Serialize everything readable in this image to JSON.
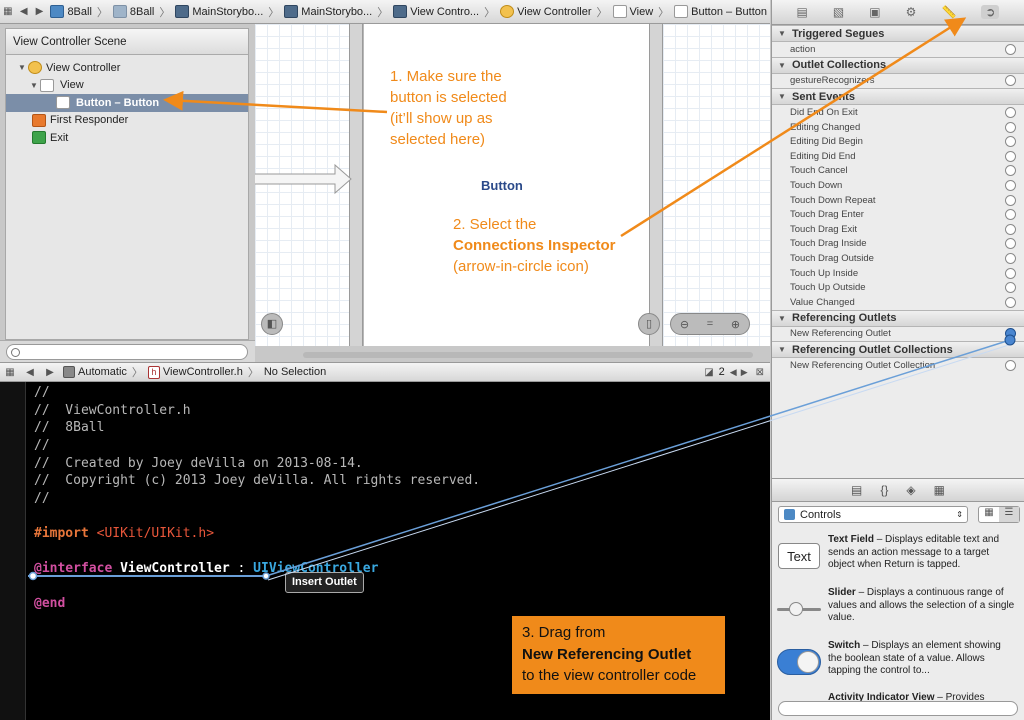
{
  "jumpbar_top": {
    "crumbs": [
      "8Ball",
      "8Ball",
      "MainStorybo...",
      "MainStorybo...",
      "View Contro...",
      "View Controller",
      "View",
      "Button – Button"
    ]
  },
  "outline": {
    "scene": "View Controller Scene",
    "items": [
      "View Controller",
      "View",
      "Button – Button",
      "First Responder",
      "Exit"
    ]
  },
  "canvas": {
    "button_label": "Button"
  },
  "inspector": {
    "sections": [
      {
        "title": "Triggered Segues",
        "rows": [
          "action"
        ]
      },
      {
        "title": "Outlet Collections",
        "rows": [
          "gestureRecognizers"
        ]
      },
      {
        "title": "Sent Events",
        "rows": [
          "Did End On Exit",
          "Editing Changed",
          "Editing Did Begin",
          "Editing Did End",
          "Touch Cancel",
          "Touch Down",
          "Touch Down Repeat",
          "Touch Drag Enter",
          "Touch Drag Exit",
          "Touch Drag Inside",
          "Touch Drag Outside",
          "Touch Up Inside",
          "Touch Up Outside",
          "Value Changed"
        ]
      },
      {
        "title": "Referencing Outlets",
        "rows": [
          "New Referencing Outlet"
        ]
      },
      {
        "title": "Referencing Outlet Collections",
        "rows": [
          "New Referencing Outlet Collection"
        ]
      }
    ]
  },
  "editor_bar": {
    "mode": "Automatic",
    "file": "ViewController.h",
    "selection": "No Selection",
    "counterpart_count": "2"
  },
  "code": {
    "l1": "//",
    "l2": "//  ViewController.h",
    "l3": "//  8Ball",
    "l4": "//",
    "l5": "//  Created by Joey deVilla on 2013-08-14.",
    "l6": "//  Copyright (c) 2013 Joey deVilla. All rights reserved.",
    "l7": "//",
    "import_kw": "#import",
    "import_val": "<UIKit/UIKit.h>",
    "iface_kw": "@interface",
    "iface_name": "ViewController",
    "iface_colon": ":",
    "iface_super": "UIViewController",
    "end_kw": "@end"
  },
  "tooltip": "Insert Outlet",
  "annotations": {
    "a1": [
      "1. Make sure the",
      "button is selected",
      "(it’ll show up as",
      "selected here)"
    ],
    "a2_1": "2. Select the",
    "a2_2": "Connections Inspector",
    "a2_3": "(arrow-in-circle icon)",
    "a3_1": "3. Drag from",
    "a3_2": "New Referencing Outlet",
    "a3_3": "to the view controller code"
  },
  "library": {
    "dropdown": "Controls",
    "items": [
      {
        "thumb": "Text",
        "name": "Text Field",
        "desc": " – Displays editable text and sends an action message to a target object when Return is tapped."
      },
      {
        "name": "Slider",
        "desc": " – Displays a continuous range of values and allows the selection of a single value."
      },
      {
        "name": "Switch",
        "desc": " – Displays an element showing the boolean state of a value. Allows tapping the control to..."
      },
      {
        "name": "Activity Indicator View",
        "desc": " – Provides"
      }
    ]
  },
  "colors": {
    "annotation": "#f08a1a",
    "connection_line": "#6a9fd8",
    "code_keyword": "#d14fa0",
    "code_string": "#e8563a",
    "code_class": "#3aa8e0",
    "code_comment": "#b8b8b8"
  }
}
